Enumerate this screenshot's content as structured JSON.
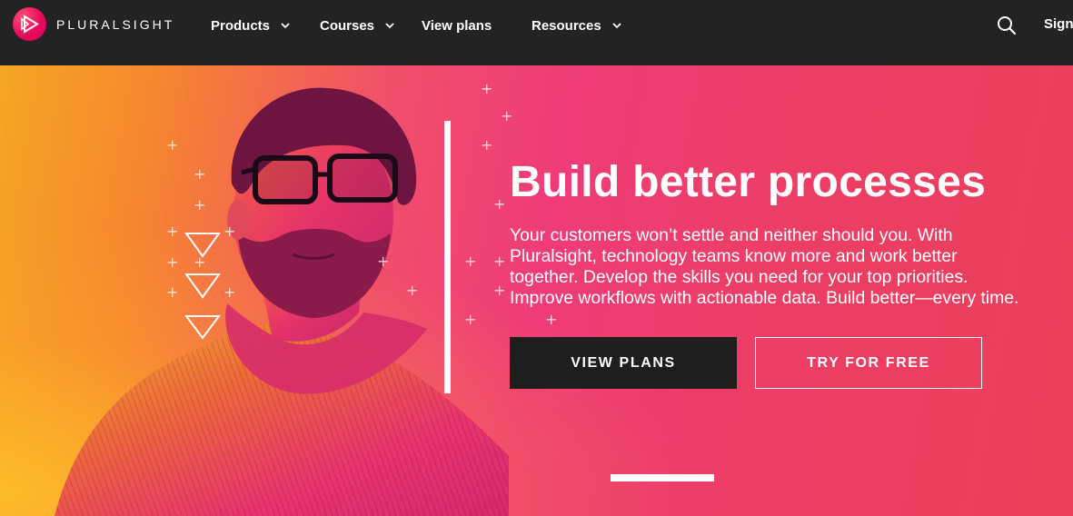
{
  "brand": {
    "name": "PLURALSIGHT",
    "accent_color": "#e80a5a"
  },
  "nav": {
    "items": [
      {
        "label": "Products",
        "has_dropdown": true
      },
      {
        "label": "Courses",
        "has_dropdown": true
      },
      {
        "label": "View plans",
        "has_dropdown": false
      },
      {
        "label": "Resources",
        "has_dropdown": true
      }
    ],
    "search_icon": "search-icon",
    "signin_label": "Sign"
  },
  "hero": {
    "headline": "Build better processes",
    "body_lines": [
      "Your customers won’t settle and neither should you. With",
      "Pluralsight, technology teams know more and work better",
      "together. Develop the skills you need for your top priorities.",
      "Improve workflows with actionable data. Build better—every time."
    ],
    "primary_button": "VIEW PLANS",
    "secondary_button": "TRY FOR FREE",
    "colors": {
      "gradient_orange": "#f5a623",
      "gradient_pink": "#ef3c78",
      "gradient_red": "#ea3f59",
      "primary_button_bg": "#1e1e1e"
    }
  }
}
